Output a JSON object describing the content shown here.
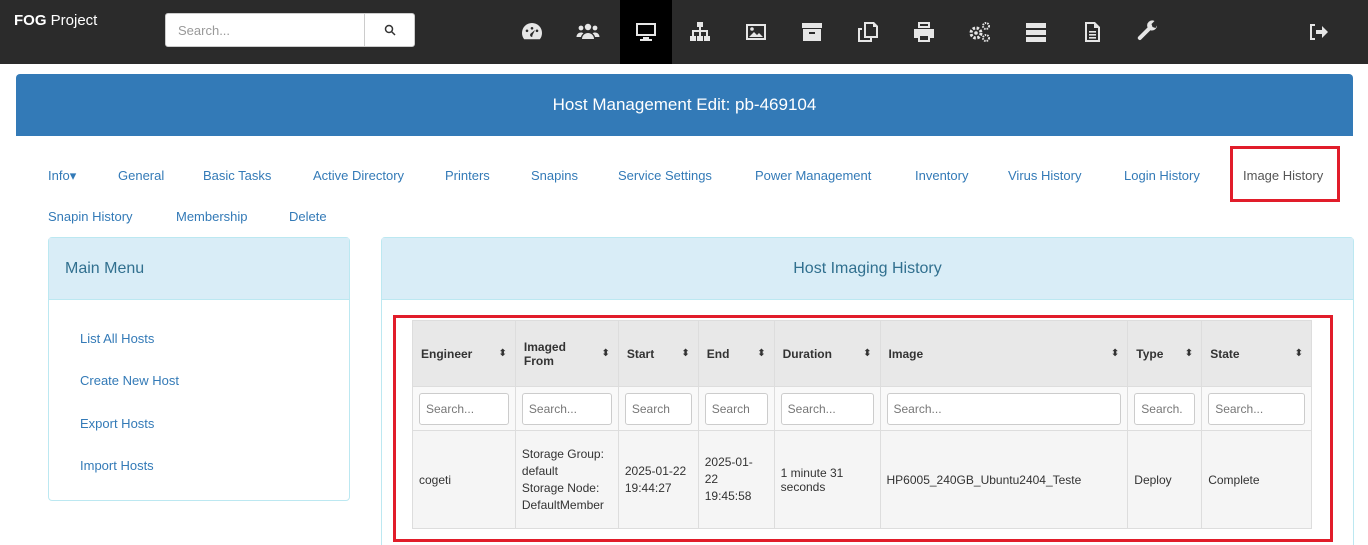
{
  "navbar": {
    "brand_bold": "FOG",
    "brand_rest": " Project",
    "search_placeholder": "Search...",
    "icons": [
      "dashboard-icon",
      "users-icon",
      "hosts-icon",
      "groups-icon",
      "images-icon",
      "storage-icon",
      "snapins-icon",
      "printers-icon",
      "services-icon",
      "tasks-icon",
      "reports-icon",
      "settings-icon",
      "logout-icon"
    ],
    "active_icon": "hosts-icon"
  },
  "page": {
    "title": "Host Management Edit: pb-469104"
  },
  "tabs": [
    "Info",
    "General",
    "Basic Tasks",
    "Active Directory",
    "Printers",
    "Snapins",
    "Service Settings",
    "Power Management",
    "Inventory",
    "Virus History",
    "Login History",
    "Image History",
    "Snapin History",
    "Membership",
    "Delete"
  ],
  "info_caret": "▾",
  "highlighted_tab": "Image History",
  "main_menu": {
    "title": "Main Menu",
    "links": [
      "List All Hosts",
      "Create New Host",
      "Export Hosts",
      "Import Hosts"
    ]
  },
  "history": {
    "title": "Host Imaging History",
    "columns": [
      "Engineer",
      "Imaged From",
      "Start",
      "End",
      "Duration",
      "Image",
      "Type",
      "State"
    ],
    "filter_placeholders": [
      "Search...",
      "Search...",
      "Search",
      "Search",
      "Search...",
      "Search...",
      "Search.",
      "Search..."
    ],
    "rows": [
      {
        "engineer": "cogeti",
        "imaged_from": [
          "Storage Group:",
          "default",
          "Storage Node:",
          "DefaultMember"
        ],
        "start": [
          "2025-01-22",
          "19:44:27"
        ],
        "end": [
          "2025-01-",
          "22",
          "19:45:58"
        ],
        "duration": [
          "1 minute 31",
          "seconds"
        ],
        "image": "HP6005_240GB_Ubuntu2404_Teste",
        "type": "Deploy",
        "state": "Complete"
      }
    ]
  },
  "colors": {
    "navbar": "#2b2b2b",
    "header": "#337ab7",
    "panel_head": "#d9edf7",
    "highlight": "#e11d2a",
    "link": "#337ab7"
  }
}
